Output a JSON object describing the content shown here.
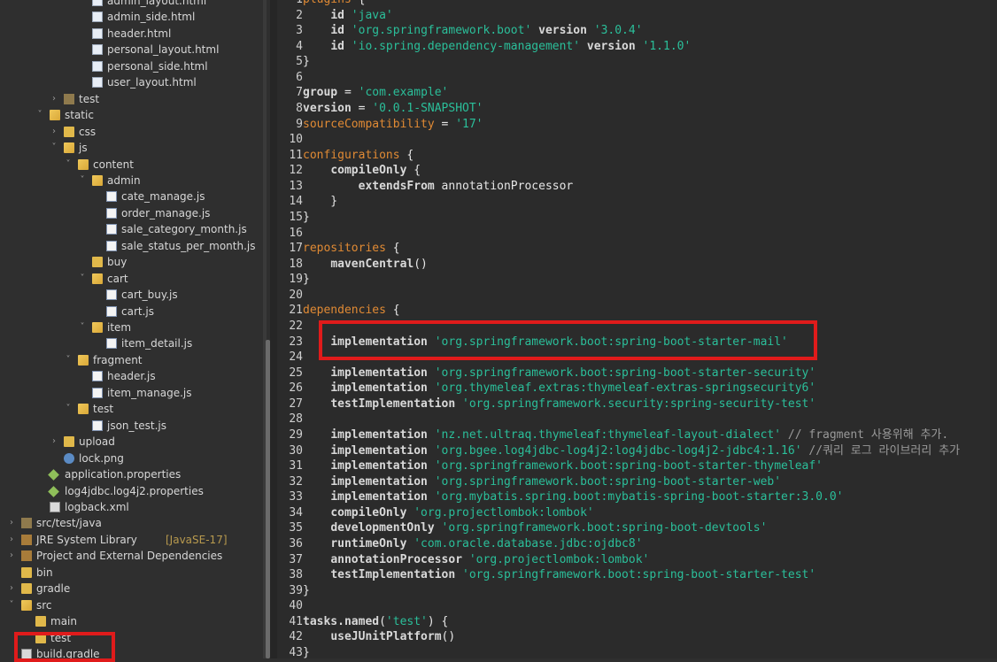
{
  "explorer": {
    "items": [
      {
        "label": "admin_layout.html",
        "depth": 5,
        "icon": "html-file",
        "twisty": ""
      },
      {
        "label": "admin_side.html",
        "depth": 5,
        "icon": "html-file",
        "twisty": ""
      },
      {
        "label": "header.html",
        "depth": 5,
        "icon": "html-file",
        "twisty": ""
      },
      {
        "label": "personal_layout.html",
        "depth": 5,
        "icon": "html-file",
        "twisty": ""
      },
      {
        "label": "personal_side.html",
        "depth": 5,
        "icon": "html-file",
        "twisty": ""
      },
      {
        "label": "user_layout.html",
        "depth": 5,
        "icon": "html-file",
        "twisty": ""
      },
      {
        "label": "test",
        "depth": 3,
        "icon": "package",
        "twisty": ">"
      },
      {
        "label": "static",
        "depth": 2,
        "icon": "folder-open",
        "twisty": "v"
      },
      {
        "label": "css",
        "depth": 3,
        "icon": "folder",
        "twisty": ">"
      },
      {
        "label": "js",
        "depth": 3,
        "icon": "folder-open",
        "twisty": "v"
      },
      {
        "label": "content",
        "depth": 4,
        "icon": "folder-open",
        "twisty": "v"
      },
      {
        "label": "admin",
        "depth": 5,
        "icon": "folder-open",
        "twisty": "v"
      },
      {
        "label": "cate_manage.js",
        "depth": 6,
        "icon": "js-file",
        "twisty": ""
      },
      {
        "label": "order_manage.js",
        "depth": 6,
        "icon": "js-file",
        "twisty": ""
      },
      {
        "label": "sale_category_month.js",
        "depth": 6,
        "icon": "js-file",
        "twisty": ""
      },
      {
        "label": "sale_status_per_month.js",
        "depth": 6,
        "icon": "js-file",
        "twisty": ""
      },
      {
        "label": "buy",
        "depth": 5,
        "icon": "folder",
        "twisty": ""
      },
      {
        "label": "cart",
        "depth": 5,
        "icon": "folder-open",
        "twisty": "v"
      },
      {
        "label": "cart_buy.js",
        "depth": 6,
        "icon": "js-file",
        "twisty": ""
      },
      {
        "label": "cart.js",
        "depth": 6,
        "icon": "js-file",
        "twisty": ""
      },
      {
        "label": "item",
        "depth": 5,
        "icon": "folder-open",
        "twisty": "v"
      },
      {
        "label": "item_detail.js",
        "depth": 6,
        "icon": "js-file",
        "twisty": ""
      },
      {
        "label": "fragment",
        "depth": 4,
        "icon": "folder-open",
        "twisty": "v"
      },
      {
        "label": "header.js",
        "depth": 5,
        "icon": "js-file",
        "twisty": ""
      },
      {
        "label": "item_manage.js",
        "depth": 5,
        "icon": "js-file",
        "twisty": ""
      },
      {
        "label": "test",
        "depth": 4,
        "icon": "folder-open",
        "twisty": "v"
      },
      {
        "label": "json_test.js",
        "depth": 5,
        "icon": "js-file",
        "twisty": ""
      },
      {
        "label": "upload",
        "depth": 3,
        "icon": "folder",
        "twisty": ">"
      },
      {
        "label": "lock.png",
        "depth": 3,
        "icon": "image-file",
        "twisty": ""
      },
      {
        "label": "application.properties",
        "depth": 2,
        "icon": "properties-file",
        "twisty": ""
      },
      {
        "label": "log4jdbc.log4j2.properties",
        "depth": 2,
        "icon": "properties-file",
        "twisty": ""
      },
      {
        "label": "logback.xml",
        "depth": 2,
        "icon": "xml-file",
        "twisty": ""
      },
      {
        "label": "src/test/java",
        "depth": 0,
        "icon": "source-folder",
        "twisty": ">"
      },
      {
        "label": "JRE System Library",
        "decoration": "[JavaSE-17]",
        "depth": 0,
        "icon": "library",
        "twisty": ">"
      },
      {
        "label": "Project and External Dependencies",
        "depth": 0,
        "icon": "library",
        "twisty": ">"
      },
      {
        "label": "bin",
        "depth": 0,
        "icon": "folder",
        "twisty": ""
      },
      {
        "label": "gradle",
        "depth": 0,
        "icon": "folder",
        "twisty": ">"
      },
      {
        "label": "src",
        "depth": 0,
        "icon": "folder-open",
        "twisty": "v"
      },
      {
        "label": "main",
        "depth": 1,
        "icon": "folder",
        "twisty": ""
      },
      {
        "label": "test",
        "depth": 1,
        "icon": "folder",
        "twisty": ""
      },
      {
        "label": "build.gradle",
        "depth": 0,
        "icon": "gradle-file",
        "twisty": ""
      }
    ]
  },
  "editor": {
    "lines": [
      {
        "n": "1",
        "parts": [
          [
            "org",
            "plugins"
          ],
          [
            "cd",
            " {"
          ]
        ]
      },
      {
        "n": "2",
        "parts": [
          [
            "cd",
            "    "
          ],
          [
            "kw",
            "id"
          ],
          [
            "cd",
            " "
          ],
          [
            "str",
            "'java'"
          ]
        ]
      },
      {
        "n": "3",
        "parts": [
          [
            "cd",
            "    "
          ],
          [
            "kw",
            "id"
          ],
          [
            "cd",
            " "
          ],
          [
            "str",
            "'org.springframework.boot'"
          ],
          [
            "cd",
            " "
          ],
          [
            "kw",
            "version"
          ],
          [
            "cd",
            " "
          ],
          [
            "str",
            "'3.0.4'"
          ]
        ]
      },
      {
        "n": "4",
        "parts": [
          [
            "cd",
            "    "
          ],
          [
            "kw",
            "id"
          ],
          [
            "cd",
            " "
          ],
          [
            "str",
            "'io.spring.dependency-management'"
          ],
          [
            "cd",
            " "
          ],
          [
            "kw",
            "version"
          ],
          [
            "cd",
            " "
          ],
          [
            "str",
            "'1.1.0'"
          ]
        ]
      },
      {
        "n": "5",
        "parts": [
          [
            "cd",
            "}"
          ]
        ]
      },
      {
        "n": "6",
        "parts": []
      },
      {
        "n": "7",
        "parts": [
          [
            "kw",
            "group"
          ],
          [
            "cd",
            " = "
          ],
          [
            "str",
            "'com.example'"
          ]
        ]
      },
      {
        "n": "8",
        "parts": [
          [
            "kw",
            "version"
          ],
          [
            "cd",
            " = "
          ],
          [
            "str",
            "'0.0.1-SNAPSHOT'"
          ]
        ]
      },
      {
        "n": "9",
        "parts": [
          [
            "org",
            "sourceCompatibility"
          ],
          [
            "cd",
            " = "
          ],
          [
            "str",
            "'17'"
          ]
        ]
      },
      {
        "n": "10",
        "parts": []
      },
      {
        "n": "11",
        "parts": [
          [
            "org",
            "configurations"
          ],
          [
            "cd",
            " {"
          ]
        ]
      },
      {
        "n": "12",
        "parts": [
          [
            "cd",
            "    "
          ],
          [
            "kw",
            "compileOnly"
          ],
          [
            "cd",
            " {"
          ]
        ]
      },
      {
        "n": "13",
        "parts": [
          [
            "cd",
            "        "
          ],
          [
            "kw",
            "extendsFrom"
          ],
          [
            "cd",
            " annotationProcessor"
          ]
        ]
      },
      {
        "n": "14",
        "parts": [
          [
            "cd",
            "    }"
          ]
        ]
      },
      {
        "n": "15",
        "parts": [
          [
            "cd",
            "}"
          ]
        ]
      },
      {
        "n": "16",
        "parts": []
      },
      {
        "n": "17",
        "parts": [
          [
            "org",
            "repositories"
          ],
          [
            "cd",
            " {"
          ]
        ]
      },
      {
        "n": "18",
        "parts": [
          [
            "cd",
            "    "
          ],
          [
            "kw",
            "mavenCentral"
          ],
          [
            "cd",
            "()"
          ]
        ]
      },
      {
        "n": "19",
        "parts": [
          [
            "cd",
            "}"
          ]
        ]
      },
      {
        "n": "20",
        "parts": []
      },
      {
        "n": "21",
        "parts": [
          [
            "org",
            "dependencies"
          ],
          [
            "cd",
            " {"
          ]
        ]
      },
      {
        "n": "22",
        "parts": []
      },
      {
        "n": "23",
        "parts": [
          [
            "cd",
            "    "
          ],
          [
            "kw",
            "implementation"
          ],
          [
            "cd",
            " "
          ],
          [
            "str",
            "'org.springframework.boot:spring-boot-starter-mail'"
          ]
        ]
      },
      {
        "n": "24",
        "parts": []
      },
      {
        "n": "25",
        "parts": [
          [
            "cd",
            "    "
          ],
          [
            "kw",
            "implementation"
          ],
          [
            "cd",
            " "
          ],
          [
            "str",
            "'org.springframework.boot:spring-boot-starter-security'"
          ]
        ]
      },
      {
        "n": "26",
        "parts": [
          [
            "cd",
            "    "
          ],
          [
            "kw",
            "implementation"
          ],
          [
            "cd",
            " "
          ],
          [
            "str",
            "'org.thymeleaf.extras:thymeleaf-extras-springsecurity6'"
          ]
        ]
      },
      {
        "n": "27",
        "parts": [
          [
            "cd",
            "    "
          ],
          [
            "kw",
            "testImplementation"
          ],
          [
            "cd",
            " "
          ],
          [
            "str",
            "'org.springframework.security:spring-security-test'"
          ]
        ]
      },
      {
        "n": "28",
        "parts": []
      },
      {
        "n": "29",
        "parts": [
          [
            "cd",
            "    "
          ],
          [
            "kw",
            "implementation"
          ],
          [
            "cd",
            " "
          ],
          [
            "str",
            "'nz.net.ultraq.thymeleaf:thymeleaf-layout-dialect'"
          ],
          [
            "cd",
            " "
          ],
          [
            "cm",
            "// fragment 사용위해 추가."
          ]
        ]
      },
      {
        "n": "30",
        "parts": [
          [
            "cd",
            "    "
          ],
          [
            "kw",
            "implementation"
          ],
          [
            "cd",
            " "
          ],
          [
            "str",
            "'org.bgee.log4jdbc-log4j2:log4jdbc-log4j2-jdbc4:1.16'"
          ],
          [
            "cd",
            " "
          ],
          [
            "cm",
            "//쿼리 로그 라이브러리 추가"
          ]
        ]
      },
      {
        "n": "31",
        "parts": [
          [
            "cd",
            "    "
          ],
          [
            "kw",
            "implementation"
          ],
          [
            "cd",
            " "
          ],
          [
            "str",
            "'org.springframework.boot:spring-boot-starter-thymeleaf'"
          ]
        ]
      },
      {
        "n": "32",
        "parts": [
          [
            "cd",
            "    "
          ],
          [
            "kw",
            "implementation"
          ],
          [
            "cd",
            " "
          ],
          [
            "str",
            "'org.springframework.boot:spring-boot-starter-web'"
          ]
        ]
      },
      {
        "n": "33",
        "parts": [
          [
            "cd",
            "    "
          ],
          [
            "kw",
            "implementation"
          ],
          [
            "cd",
            " "
          ],
          [
            "str",
            "'org.mybatis.spring.boot:mybatis-spring-boot-starter:3.0.0'"
          ]
        ]
      },
      {
        "n": "34",
        "parts": [
          [
            "cd",
            "    "
          ],
          [
            "kw",
            "compileOnly"
          ],
          [
            "cd",
            " "
          ],
          [
            "str",
            "'org.projectlombok:lombok'"
          ]
        ]
      },
      {
        "n": "35",
        "parts": [
          [
            "cd",
            "    "
          ],
          [
            "kw",
            "developmentOnly"
          ],
          [
            "cd",
            " "
          ],
          [
            "str",
            "'org.springframework.boot:spring-boot-devtools'"
          ]
        ]
      },
      {
        "n": "36",
        "parts": [
          [
            "cd",
            "    "
          ],
          [
            "kw",
            "runtimeOnly"
          ],
          [
            "cd",
            " "
          ],
          [
            "str",
            "'com.oracle.database.jdbc:ojdbc8'"
          ]
        ]
      },
      {
        "n": "37",
        "parts": [
          [
            "cd",
            "    "
          ],
          [
            "kw",
            "annotationProcessor"
          ],
          [
            "cd",
            " "
          ],
          [
            "str",
            "'org.projectlombok:lombok'"
          ]
        ]
      },
      {
        "n": "38",
        "parts": [
          [
            "cd",
            "    "
          ],
          [
            "kw",
            "testImplementation"
          ],
          [
            "cd",
            " "
          ],
          [
            "str",
            "'org.springframework.boot:spring-boot-starter-test'"
          ]
        ]
      },
      {
        "n": "39",
        "parts": [
          [
            "cd",
            "}"
          ]
        ]
      },
      {
        "n": "40",
        "parts": []
      },
      {
        "n": "41",
        "parts": [
          [
            "kw",
            "tasks.named"
          ],
          [
            "cd",
            "("
          ],
          [
            "str",
            "'test'"
          ],
          [
            "cd",
            ") {"
          ]
        ]
      },
      {
        "n": "42",
        "parts": [
          [
            "cd",
            "    "
          ],
          [
            "kw",
            "useJUnitPlatform"
          ],
          [
            "cd",
            "()"
          ]
        ]
      },
      {
        "n": "43",
        "parts": [
          [
            "cd",
            "}"
          ]
        ]
      }
    ]
  },
  "colors": {
    "highlight": "#e01b1b",
    "string": "#2bbf9a",
    "block_keyword": "#e08a34",
    "folder": "#e0b84a"
  }
}
